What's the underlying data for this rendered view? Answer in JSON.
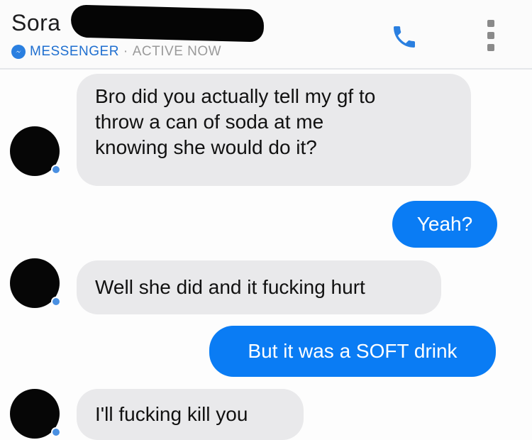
{
  "header": {
    "contact_name": "Sora",
    "platform": "MESSENGER",
    "separator": "·",
    "status": "ACTIVE NOW",
    "accent_color": "#2a7fe0"
  },
  "icons": {
    "call": "phone-icon",
    "menu": "more-vertical-icon",
    "platform": "messenger-icon"
  },
  "messages": [
    {
      "direction": "incoming",
      "text": "Bro did you actually tell my gf to\nthrow a can of soda at me\nknowing she would do it?"
    },
    {
      "direction": "outgoing",
      "text": "Yeah?"
    },
    {
      "direction": "incoming",
      "text": "Well she did and it fucking hurt"
    },
    {
      "direction": "outgoing",
      "text": "But it was a SOFT drink"
    },
    {
      "direction": "incoming",
      "text": "I'll fucking kill you"
    }
  ],
  "colors": {
    "incoming_bubble": "#e9e9eb",
    "outgoing_bubble": "#0a7cf4"
  }
}
